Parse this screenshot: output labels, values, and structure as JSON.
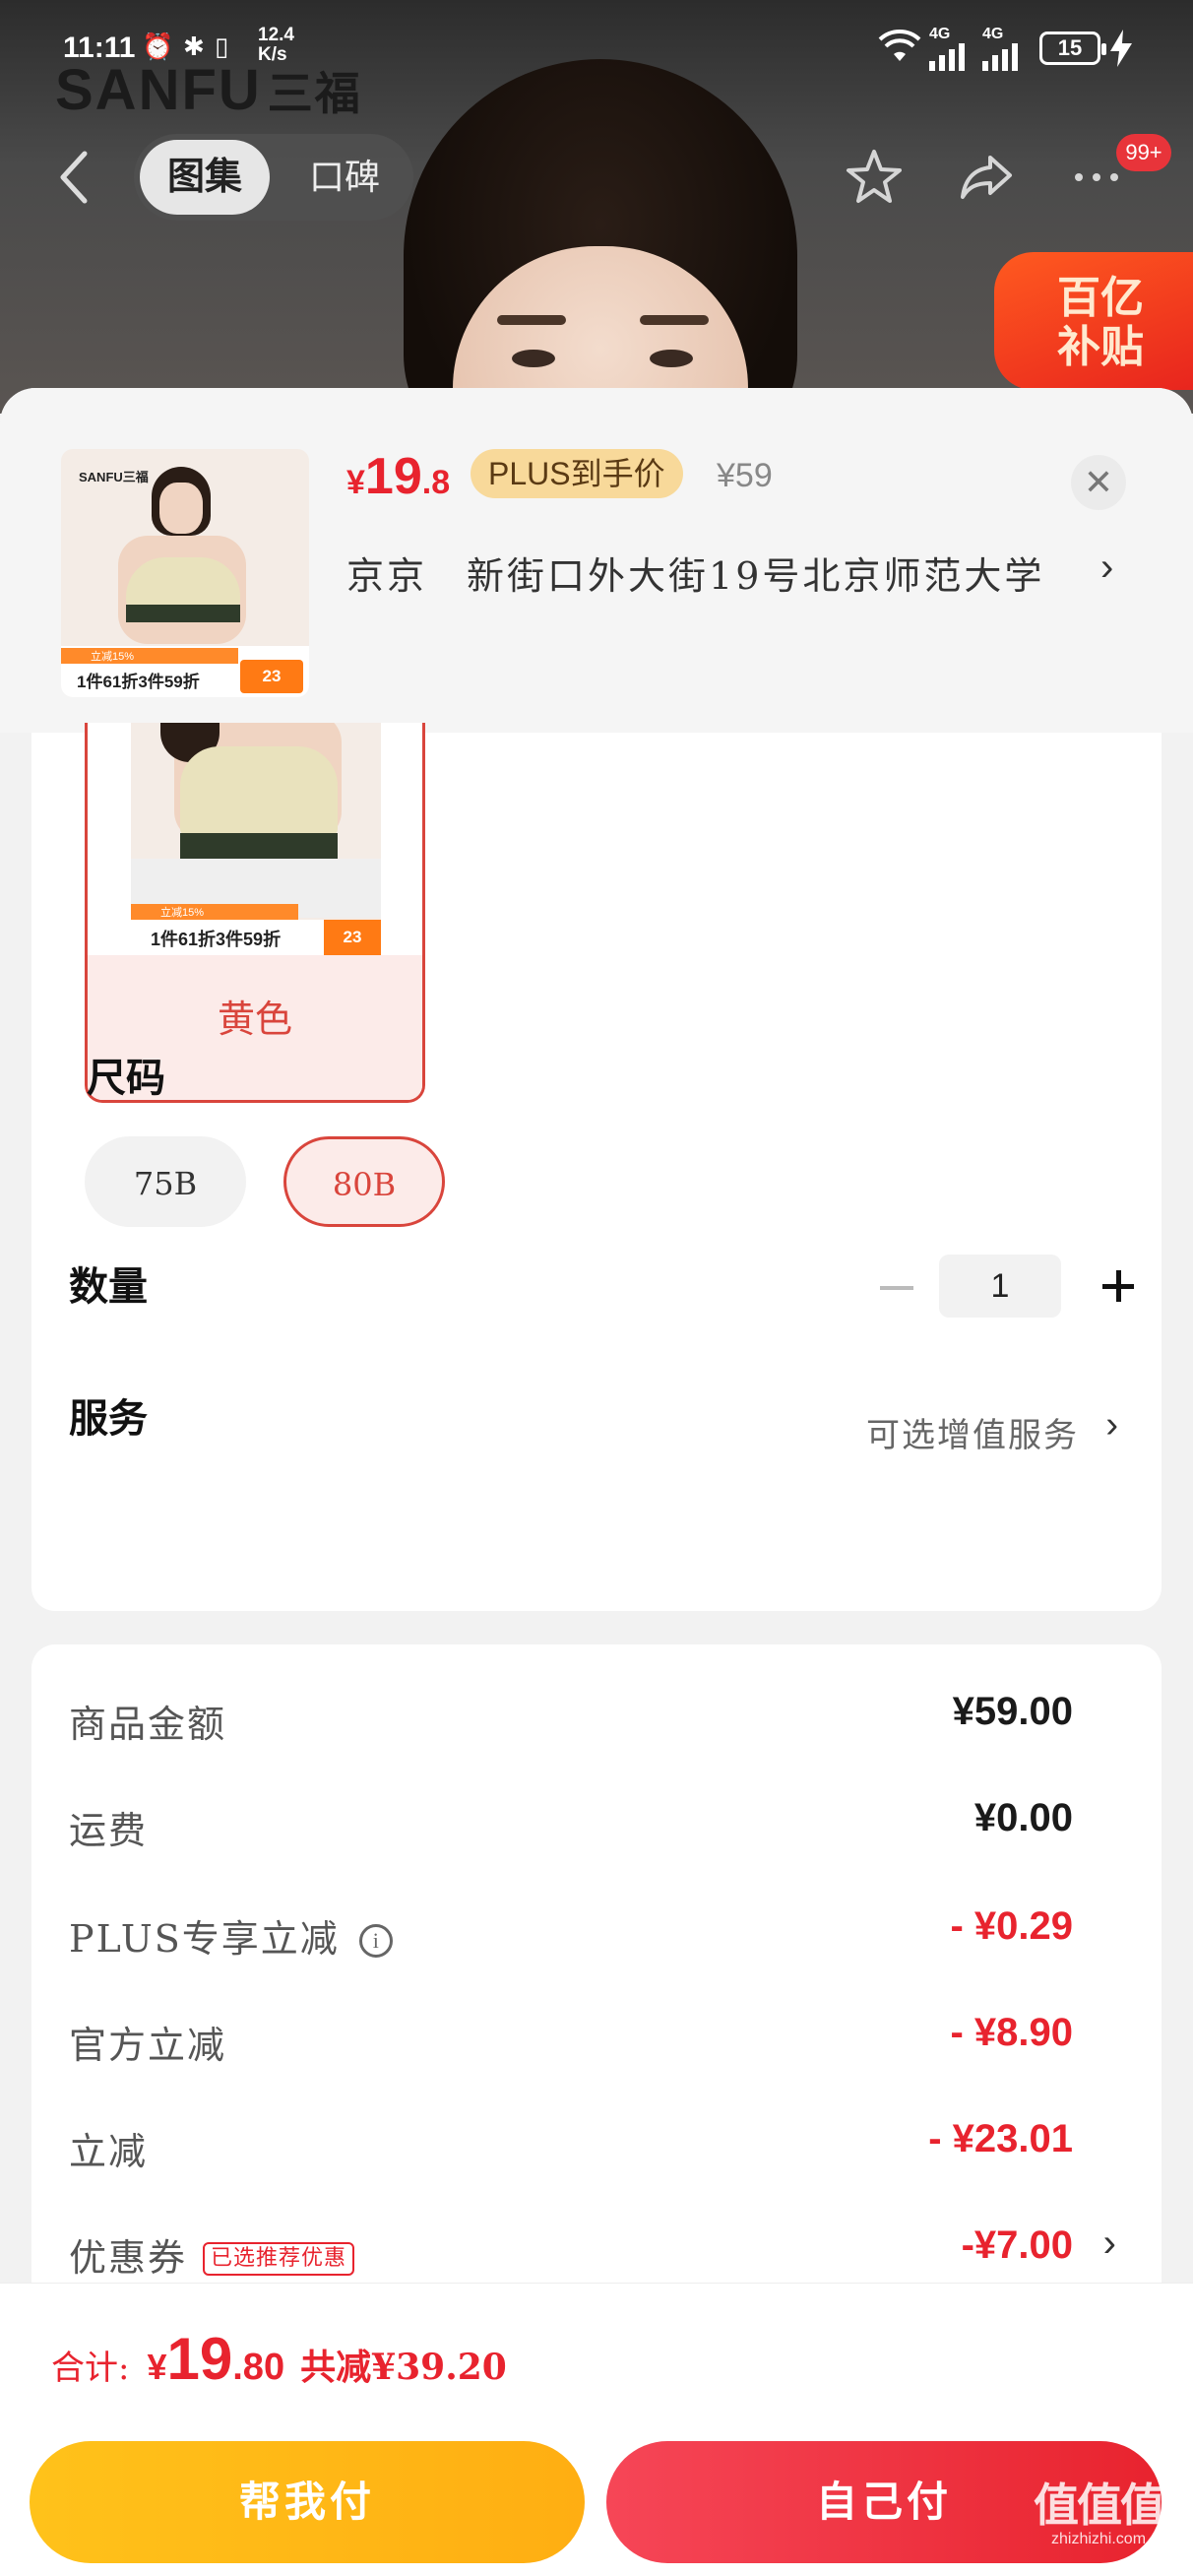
{
  "status_bar": {
    "time": "11:11",
    "net_speed_value": "12.4",
    "net_speed_unit": "K/s",
    "signal1": "4G",
    "signal2": "4G",
    "battery": "15"
  },
  "header": {
    "brand_logo": "SANFU",
    "brand_logo_cn": "三福",
    "tab_gallery": "图集",
    "tab_reviews": "口碑",
    "notification_badge": "99+",
    "promo_badge_line1": "百亿",
    "promo_badge_line2": "补贴"
  },
  "sku_sheet": {
    "price_currency": "¥",
    "price_int": "19",
    "price_dec": ".8",
    "plus_label": "PLUS到手价",
    "original_price": "¥59",
    "address_city": "京京",
    "address_detail": "新街口外大街19号北京师范大学",
    "thumb_brand": "SANFU三福",
    "thumb_promo_text": "1件61折3件59折",
    "thumb_promo_num": "23",
    "thumb_promo_sub": "立减15%"
  },
  "color_option": {
    "label": "黄色",
    "promo_text": "1件61折3件59折",
    "promo_num": "23",
    "promo_sub": "立减15%"
  },
  "size_section": {
    "title": "尺码",
    "options": [
      "75B",
      "80B"
    ],
    "selected": "80B"
  },
  "quantity_section": {
    "title": "数量",
    "value": "1"
  },
  "service_section": {
    "title": "服务",
    "value": "可选增值服务"
  },
  "price_breakdown": {
    "rows": [
      {
        "label": "商品金额",
        "value": "¥59.00"
      },
      {
        "label": "运费",
        "value": "¥0.00"
      },
      {
        "label": "PLUS专享立减",
        "value": "- ¥0.29"
      },
      {
        "label": "官方立减",
        "value": "- ¥8.90"
      },
      {
        "label": "立减",
        "value": "- ¥23.01"
      },
      {
        "label": "优惠券",
        "value": "-¥7.00"
      }
    ],
    "coupon_tag": "已选推荐优惠",
    "info_icon": "i"
  },
  "bottom_bar": {
    "total_label": "合计:",
    "total_currency": "¥",
    "total_int": "19",
    "total_dec": ".80",
    "total_saved": "共减¥39.20",
    "help_pay": "帮我付",
    "self_pay": "自己付"
  },
  "watermark": {
    "main": "值值值",
    "sub": "zhizhizhi.com"
  },
  "colors": {
    "accent_red": "#e8232e",
    "plus_gold": "#f8d99a",
    "help_pay_yellow": "#ffc21a",
    "self_pay_red": "#f64657"
  }
}
